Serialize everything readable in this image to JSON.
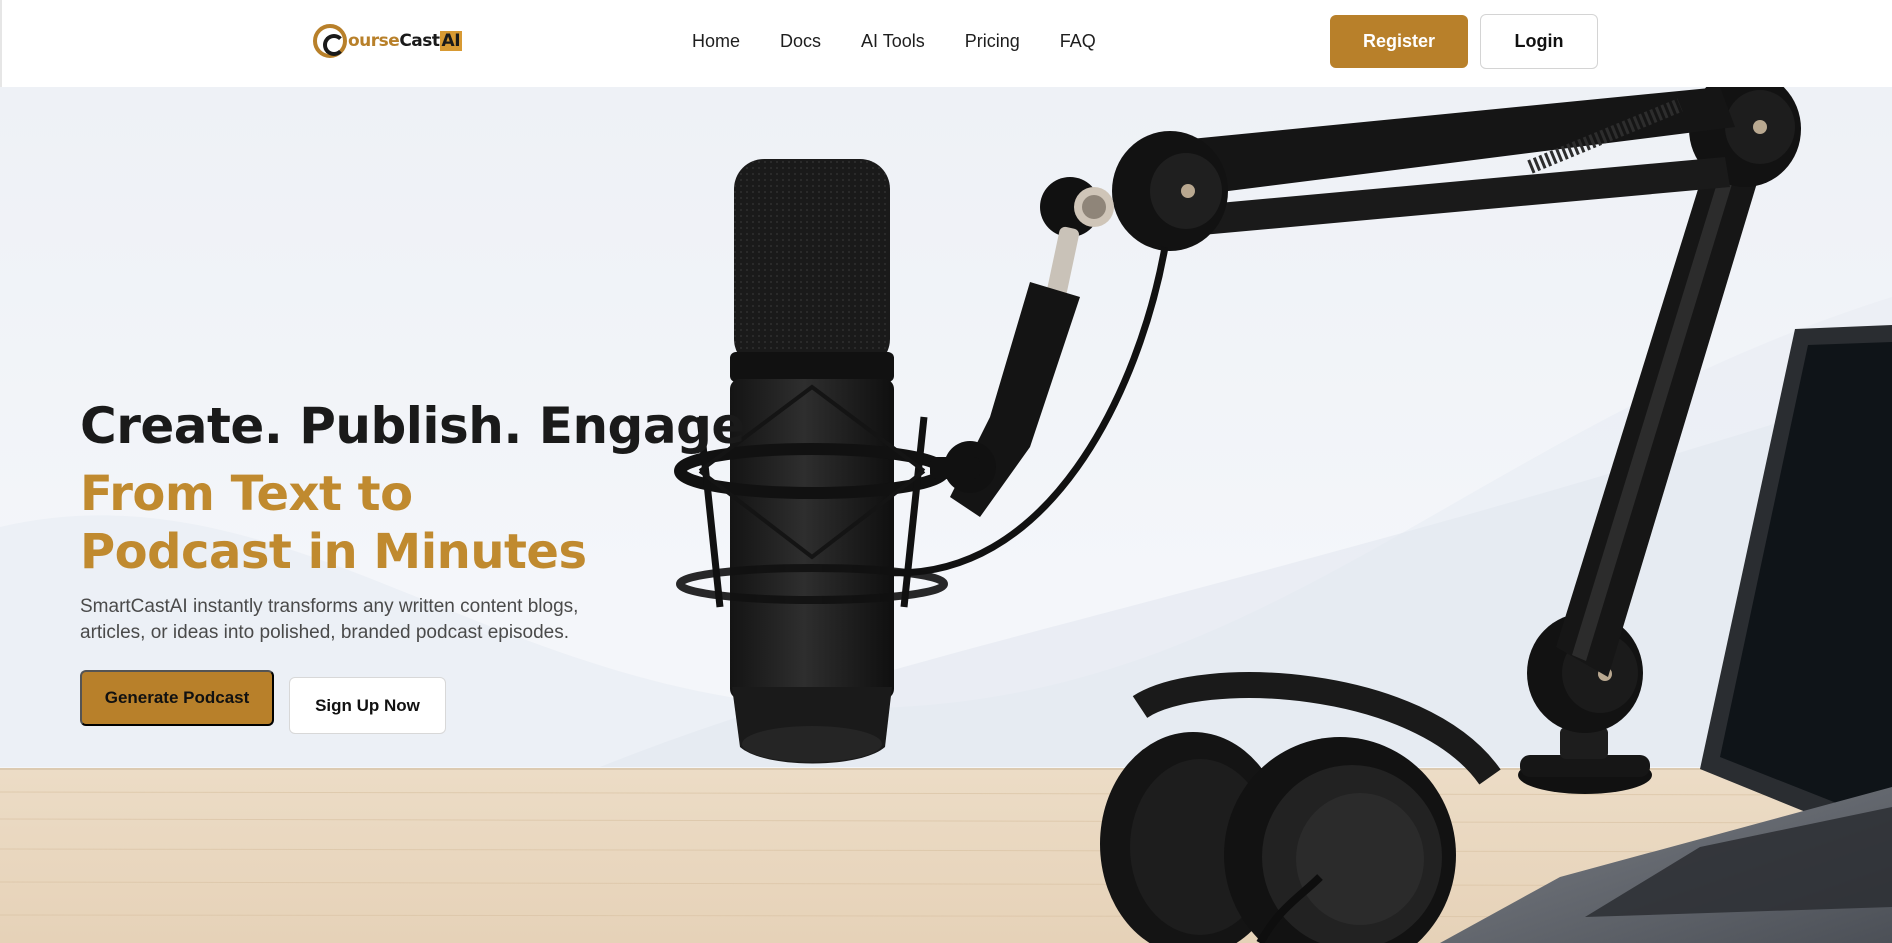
{
  "header": {
    "logo": {
      "text_main": "ourse",
      "text_tail": "Cast",
      "text_ai": "AI",
      "icon": "course-cast-logo-icon"
    },
    "nav": [
      "Home",
      "Docs",
      "AI Tools",
      "Pricing",
      "FAQ"
    ],
    "register_label": "Register",
    "login_label": "Login"
  },
  "hero": {
    "headline": "Create. Publish. Engage",
    "subheadline": "From Text to Podcast in Minutes",
    "description": "SmartCastAI instantly transforms any written content blogs, articles, or ideas into polished, branded podcast episodes.",
    "primary_cta": "Generate Podcast",
    "secondary_cta": "Sign Up Now",
    "image_subjects": [
      "microphone-icon",
      "boom-arm",
      "headphones-icon",
      "laptop-icon",
      "wooden-desk"
    ]
  },
  "colors": {
    "accent": "#b8802a",
    "subheadline": "#c08a2f",
    "text_dark": "#1a1a1a",
    "background": "#f2f4f8"
  }
}
